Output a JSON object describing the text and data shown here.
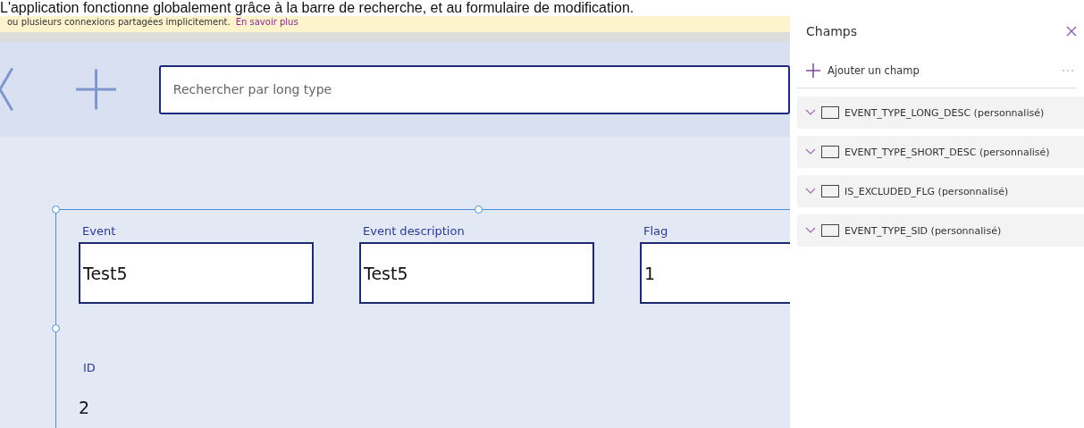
{
  "document_text": "L'application fonctionne globalement grâce à la barre de recherche, et au formulaire de modification.",
  "notice": {
    "text": "ou plusieurs connexions partagées implicitement.",
    "link": "En savoir plus"
  },
  "search": {
    "placeholder": "Rechercher par long type"
  },
  "form": {
    "fields": [
      {
        "label": "Event",
        "value": "Test5"
      },
      {
        "label": "Event description",
        "value": "Test5"
      },
      {
        "label": "Flag",
        "value": "1"
      }
    ],
    "id_field": {
      "label": "ID",
      "value": "2"
    }
  },
  "fields_panel": {
    "title": "Champs",
    "add_label": "Ajouter un champ",
    "items": [
      {
        "name": "EVENT_TYPE_LONG_DESC (personnalisé)"
      },
      {
        "name": "EVENT_TYPE_SHORT_DESC (personnalisé)"
      },
      {
        "name": "IS_EXCLUDED_FLG (personnalisé)"
      },
      {
        "name": "EVENT_TYPE_SID (personnalisé)"
      }
    ]
  }
}
